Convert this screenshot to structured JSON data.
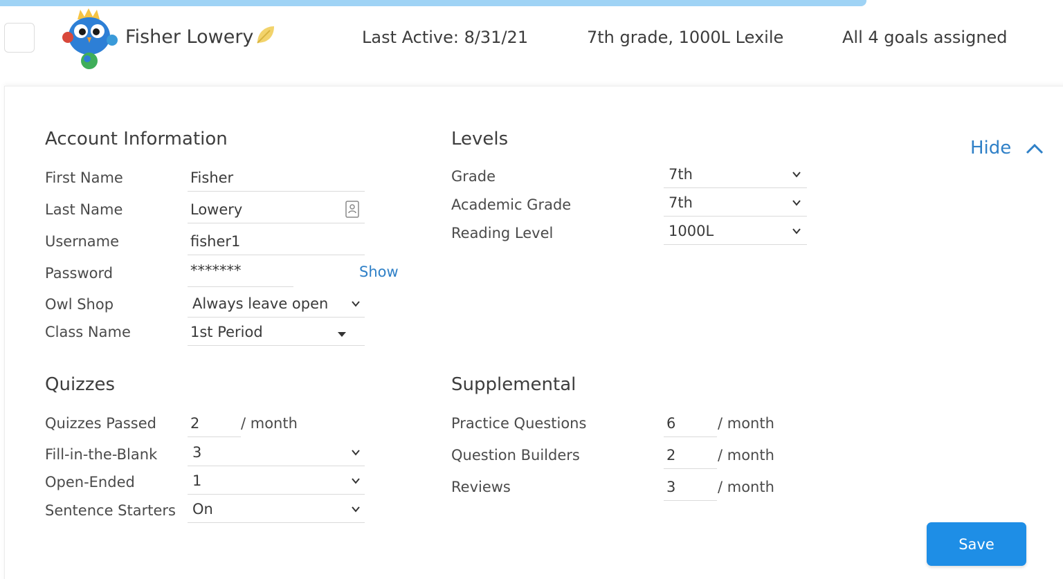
{
  "header": {
    "student_name": "Fisher Lowery",
    "last_active": "Last Active: 8/31/21",
    "grade_lexile": "7th grade, 1000L Lexile",
    "goals": "All 4 goals assigned"
  },
  "account": {
    "title": "Account Information",
    "first_name": {
      "label": "First Name",
      "value": "Fisher"
    },
    "last_name": {
      "label": "Last Name",
      "value": "Lowery"
    },
    "username": {
      "label": "Username",
      "value": "fisher1"
    },
    "password": {
      "label": "Password",
      "value": "*******",
      "show_label": "Show"
    },
    "owl_shop": {
      "label": "Owl Shop",
      "value": "Always leave open"
    },
    "class_name": {
      "label": "Class Name",
      "value": "1st Period"
    }
  },
  "levels": {
    "title": "Levels",
    "hide_label": "Hide",
    "grade": {
      "label": "Grade",
      "value": "7th"
    },
    "academic_grade": {
      "label": "Academic Grade",
      "value": "7th"
    },
    "reading_level": {
      "label": "Reading Level",
      "value": "1000L"
    }
  },
  "quizzes": {
    "title": "Quizzes",
    "passed": {
      "label": "Quizzes Passed",
      "value": "2",
      "unit": "/ month"
    },
    "fill_blank": {
      "label": "Fill-in-the-Blank",
      "value": "3"
    },
    "open_ended": {
      "label": "Open-Ended",
      "value": "1"
    },
    "sentence_starters": {
      "label": "Sentence Starters",
      "value": "On"
    }
  },
  "supplemental": {
    "title": "Supplemental",
    "practice": {
      "label": "Practice Questions",
      "value": "6",
      "unit": "/ month"
    },
    "builders": {
      "label": "Question Builders",
      "value": "2",
      "unit": "/ month"
    },
    "reviews": {
      "label": "Reviews",
      "value": "3",
      "unit": "/ month"
    }
  },
  "actions": {
    "save_label": "Save"
  },
  "colors": {
    "accent": "#1e8ee6",
    "link": "#2f80c7",
    "top_strip": "#9fd3f5"
  }
}
